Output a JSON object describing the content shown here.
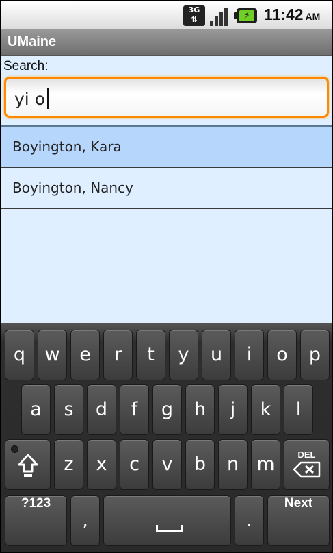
{
  "status_bar": {
    "network": "3G",
    "network_arrows": "⇅",
    "signal_icon": "signal-strength-icon",
    "battery_icon": "battery-charging-icon",
    "battery_symbol": "⚡",
    "time": "11:42",
    "ampm": "AM"
  },
  "app": {
    "title": "UMaine"
  },
  "search": {
    "label": "Search:",
    "value": "yi o"
  },
  "results": [
    {
      "name": "Boyington, Kara",
      "selected": true
    },
    {
      "name": "Boyington, Nancy",
      "selected": false
    }
  ],
  "keyboard": {
    "row1": [
      "q",
      "w",
      "e",
      "r",
      "t",
      "y",
      "u",
      "i",
      "o",
      "p"
    ],
    "row2": [
      "a",
      "s",
      "d",
      "f",
      "g",
      "h",
      "j",
      "k",
      "l"
    ],
    "row3": [
      "z",
      "x",
      "c",
      "v",
      "b",
      "n",
      "m"
    ],
    "shift_icon": "shift-arrow-icon",
    "del_label": "DEL",
    "del_icon": "backspace-icon",
    "symbols_label": "?123",
    "comma_label": ",",
    "space_icon": "space-bar-icon",
    "period_label": ".",
    "next_label": "Next"
  },
  "colors": {
    "focus_border": "#ff8a00",
    "selected_row": "#b6d7fb",
    "list_background": "#dfefff",
    "key_face": "#4a4a4a"
  }
}
